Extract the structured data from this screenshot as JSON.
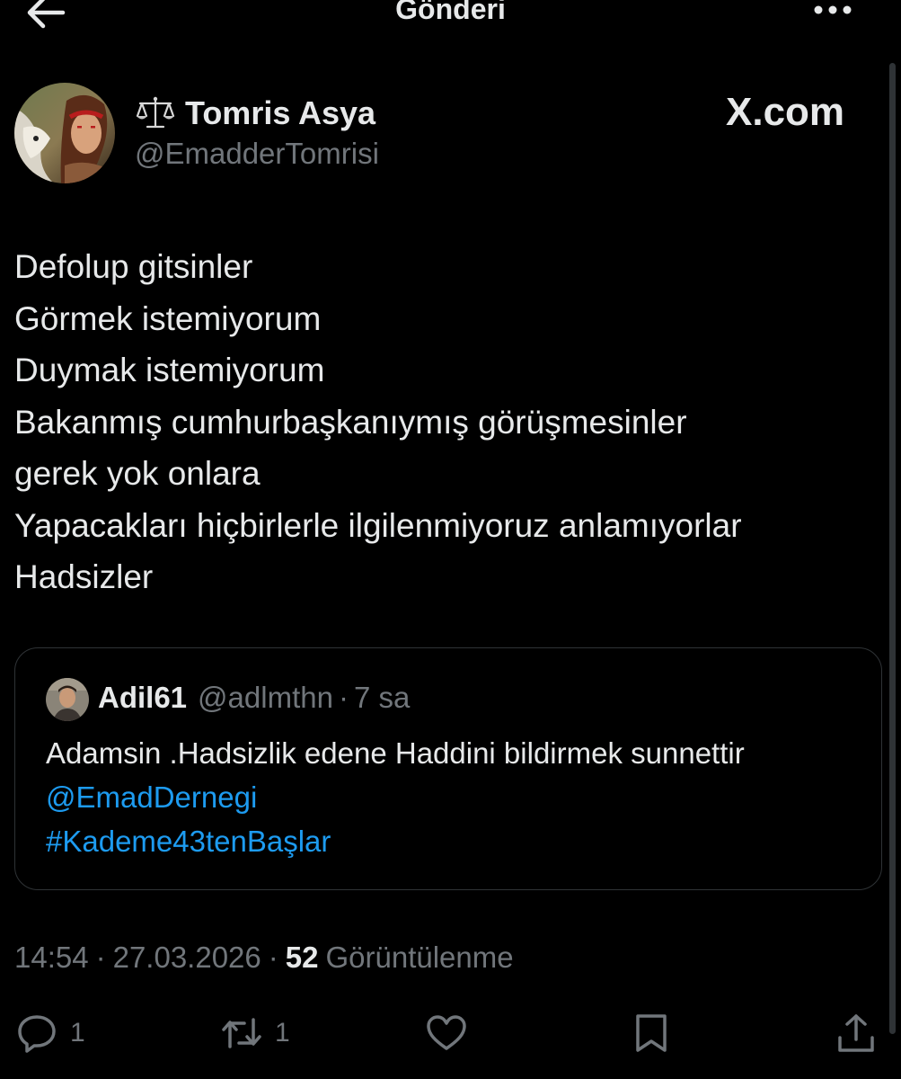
{
  "header": {
    "title": "Gönderi"
  },
  "post": {
    "author": {
      "display_name": "Tomris Asya",
      "handle": "@EmadderTomrisi",
      "name_emoji": "scales-icon"
    },
    "watermark": "X.com",
    "text_lines": [
      "Defolup gitsinler",
      "Görmek istemiyorum",
      "Duymak istemiyorum",
      "Bakanmış cumhurbaşkanıymış görüşmesinler",
      "gerek yok onlara",
      "Yapacakları hiçbirlerle ilgilenmiyoruz anlamıyorlar",
      "Hadsizler"
    ],
    "quote": {
      "display_name": "Adil61",
      "handle": "@adlmthn",
      "separator": "·",
      "time": "7 sa",
      "text": "Adamsin .Hadsizlik edene Haddini bildirmek sunnettir",
      "mention": "@EmadDernegi",
      "hashtag": "#Kademe43tenBaşlar"
    },
    "time": "14:54",
    "date": "27.03.2026",
    "separator": "·",
    "views_count": "52",
    "views_label": "Görüntülenme",
    "actions": {
      "reply_count": "1",
      "repost_count": "1"
    }
  },
  "colors": {
    "background": "#000000",
    "text_primary": "#e7e9ea",
    "text_secondary": "#71767b",
    "link": "#1d9bf0",
    "border": "#2f3336"
  }
}
